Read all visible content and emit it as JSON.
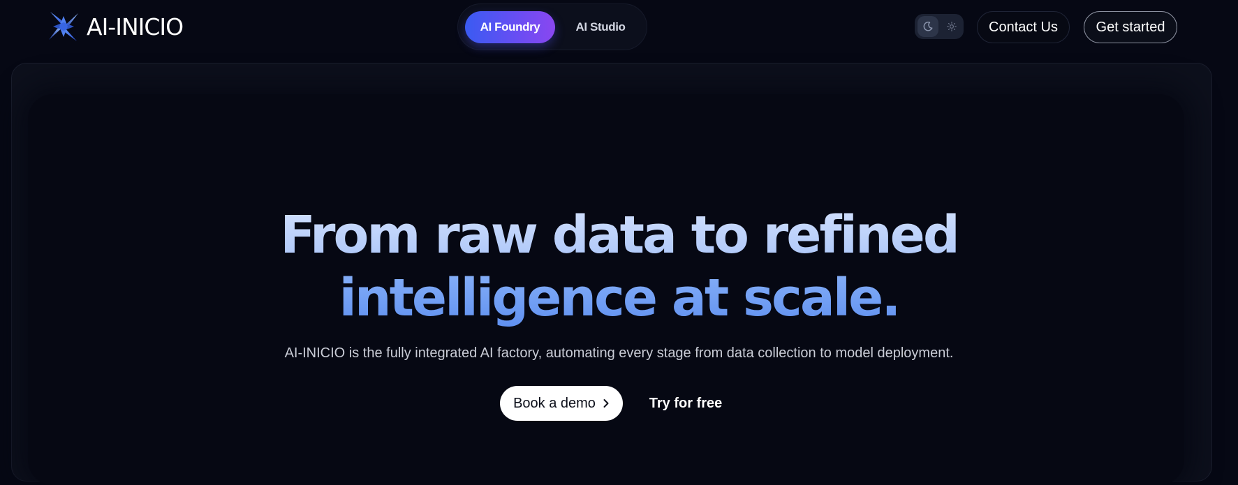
{
  "brand": {
    "name": "AI-INICIO",
    "logo_icon": "four-point-star-logo"
  },
  "product_switch": {
    "tabs": [
      {
        "label": "AI Foundry",
        "active": true
      },
      {
        "label": "AI Studio",
        "active": false
      }
    ]
  },
  "theme_toggle": {
    "options": [
      "moon-icon",
      "sun-icon"
    ],
    "selected": "dark"
  },
  "nav": {
    "contact_label": "Contact Us",
    "get_started_label": "Get started"
  },
  "hero": {
    "title_line1": "From raw data to refined",
    "title_line2": "intelligence at scale.",
    "subtitle": "AI-INICIO is the fully integrated AI factory, automating every stage from data collection to model deployment.",
    "primary_cta": "Book a demo",
    "secondary_cta": "Try for free"
  },
  "colors": {
    "background": "#060814",
    "accent_gradient_start": "#3a5bf2",
    "accent_gradient_end": "#8a47f0",
    "title_light": "#bcd3fb",
    "title_blue": "#78a3f4"
  }
}
